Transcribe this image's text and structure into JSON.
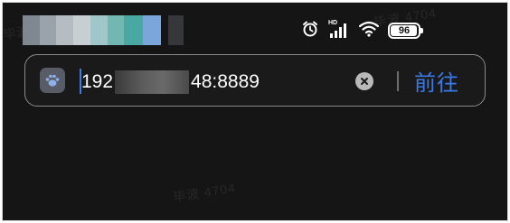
{
  "watermarks": [
    "毕波 4704",
    "毕波 4704",
    "毕波 4704"
  ],
  "status_bar": {
    "battery_level": "96",
    "signal_label": "HD"
  },
  "address_bar": {
    "url_prefix": "192",
    "url_suffix": "48:8889",
    "go_label": "前往"
  },
  "colors": {
    "background": "#151515",
    "accent": "#3a7ae6",
    "text": "#ffffff"
  }
}
